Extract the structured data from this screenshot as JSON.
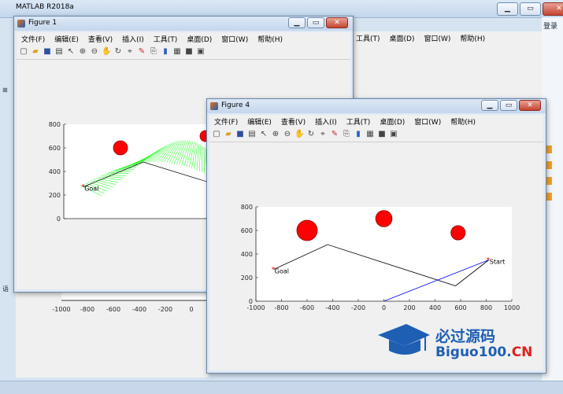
{
  "matlab": {
    "title": "MATLAB R2018a",
    "login": "登录",
    "menu_partial": [
      "工具(T)",
      "桌面(D)",
      "窗口(W)",
      "帮助(H)"
    ],
    "left_glyphs": [
      "⊞",
      "语"
    ]
  },
  "figure1": {
    "title": "Figure 1",
    "menu": [
      "文件(F)",
      "编辑(E)",
      "查看(V)",
      "插入(I)",
      "工具(T)",
      "桌面(D)",
      "窗口(W)",
      "帮助(H)"
    ],
    "plot": {
      "ylim": [
        0,
        800
      ],
      "yticks": [
        "0",
        "200",
        "400",
        "600",
        "800"
      ],
      "xticks": [
        "-1000",
        "-800",
        "-600",
        "-400",
        "-200",
        "0"
      ],
      "goal_label": "Goal",
      "obstacles": [
        {
          "x": -600,
          "y": 600
        },
        {
          "x": 0,
          "y": 700
        }
      ],
      "line_color": "#00ff00"
    }
  },
  "figure4": {
    "title": "Figure 4",
    "menu": [
      "文件(F)",
      "编辑(E)",
      "查看(V)",
      "插入(I)",
      "工具(T)",
      "桌面(D)",
      "窗口(W)",
      "帮助(H)"
    ]
  },
  "chart_data": {
    "type": "line",
    "xlim": [
      -1000,
      1000
    ],
    "ylim": [
      0,
      800
    ],
    "xticks": [
      "-1000",
      "-800",
      "-600",
      "-400",
      "-200",
      "0",
      "200",
      "400",
      "600",
      "800",
      "1000"
    ],
    "yticks": [
      "0",
      "200",
      "400",
      "600",
      "800"
    ],
    "obstacles": [
      {
        "x": -600,
        "y": 600,
        "r": 50
      },
      {
        "x": 0,
        "y": 700,
        "r": 40
      },
      {
        "x": 580,
        "y": 580,
        "r": 35
      }
    ],
    "series": [
      {
        "color": "#000000",
        "points": [
          [
            820,
            350
          ],
          [
            560,
            130
          ],
          [
            -440,
            480
          ],
          [
            -860,
            270
          ]
        ]
      },
      {
        "color": "#0000ff",
        "points": [
          [
            0,
            0
          ],
          [
            820,
            350
          ]
        ]
      }
    ],
    "labels": [
      {
        "text": "Goal",
        "x": -860,
        "y": 270
      },
      {
        "text": "Start",
        "x": 820,
        "y": 350
      }
    ]
  },
  "watermark": {
    "main": "必过源码",
    "site_prefix": "Biguo100.",
    "site_suffix": "CN"
  }
}
